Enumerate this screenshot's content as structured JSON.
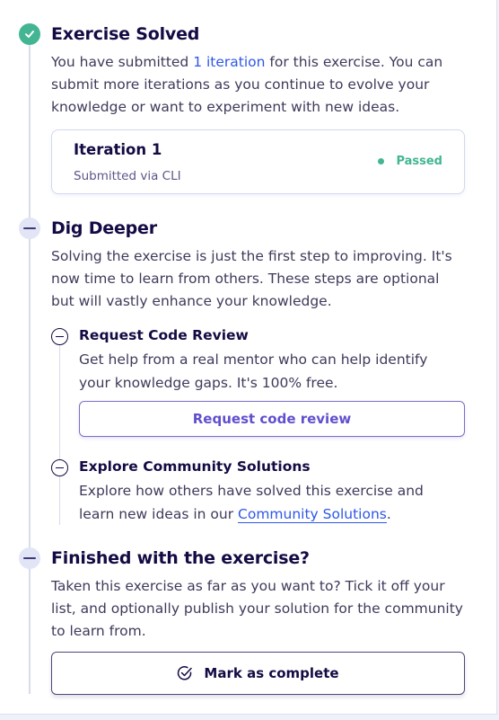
{
  "solved": {
    "title": "Exercise Solved",
    "text_before": "You have submitted ",
    "link": "1 iteration",
    "text_after_line1": " for this exercise. You can",
    "line2": "submit more iterations as you continue to evolve your",
    "line3": "knowledge or want to experiment with new ideas."
  },
  "iteration_card": {
    "title": "Iteration 1",
    "subtitle": "Submitted via CLI",
    "status": "Passed"
  },
  "dig_deeper": {
    "title": "Dig Deeper",
    "line1": "Solving the exercise is just the first step to improving. It's",
    "line2": "now time to learn from others. These steps are optional",
    "line3": "but will vastly enhance your knowledge."
  },
  "code_review": {
    "title": "Request Code Review",
    "line1": "Get help from a real mentor who can help identify",
    "line2": "your knowledge gaps. It's 100% free.",
    "button": "Request code review"
  },
  "community": {
    "title": "Explore Community Solutions",
    "line1": "Explore how others have solved this exercise and",
    "line2_before": "learn new ideas in our ",
    "link": "Community Solutions",
    "line2_after": "."
  },
  "finished": {
    "title": "Finished with the exercise?",
    "line1": "Taken this exercise as far as you want to? Tick it off your",
    "line2": "list, and optionally publish your solution for the community",
    "line3": "to learn from.",
    "button": "Mark as complete"
  },
  "colors": {
    "accent_green": "#43b593",
    "link_blue": "#2e57e8",
    "primary_purple": "#604fcd",
    "text_dark": "#130b43"
  }
}
